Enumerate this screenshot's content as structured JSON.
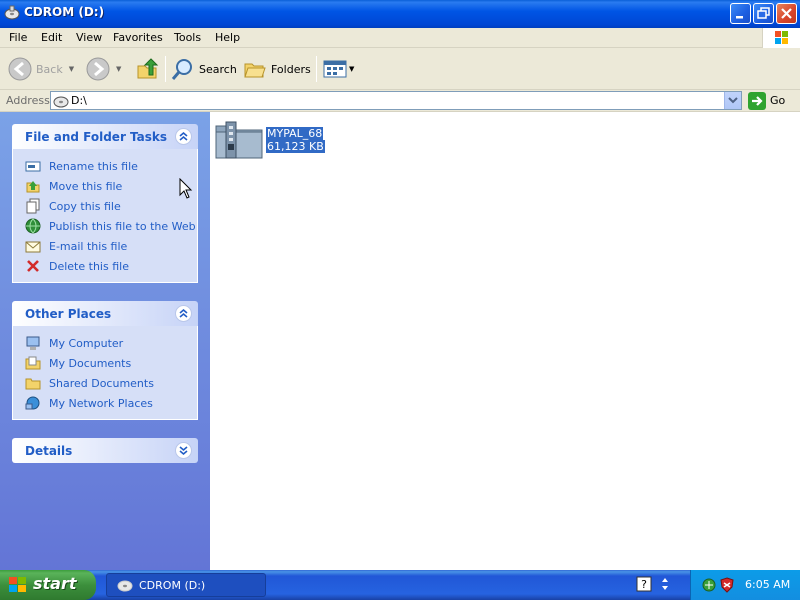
{
  "window": {
    "title": "CDROM (D:)"
  },
  "menu": [
    "File",
    "Edit",
    "View",
    "Favorites",
    "Tools",
    "Help"
  ],
  "toolbar": {
    "back": "Back",
    "search": "Search",
    "folders": "Folders"
  },
  "address": {
    "label": "Address",
    "value": "D:\\",
    "go": "Go"
  },
  "tasks": {
    "title": "File and Folder Tasks",
    "items": [
      "Rename this file",
      "Move this file",
      "Copy this file",
      "Publish this file to the Web",
      "E-mail this file",
      "Delete this file"
    ]
  },
  "other_places": {
    "title": "Other Places",
    "items": [
      "My Computer",
      "My Documents",
      "Shared Documents",
      "My Network Places"
    ]
  },
  "details": {
    "title": "Details"
  },
  "file": {
    "name": "MYPAL_68",
    "size": "61,123 KB"
  },
  "taskbar": {
    "start": "start",
    "task": "CDROM (D:)",
    "clock": "6:05 AM"
  }
}
